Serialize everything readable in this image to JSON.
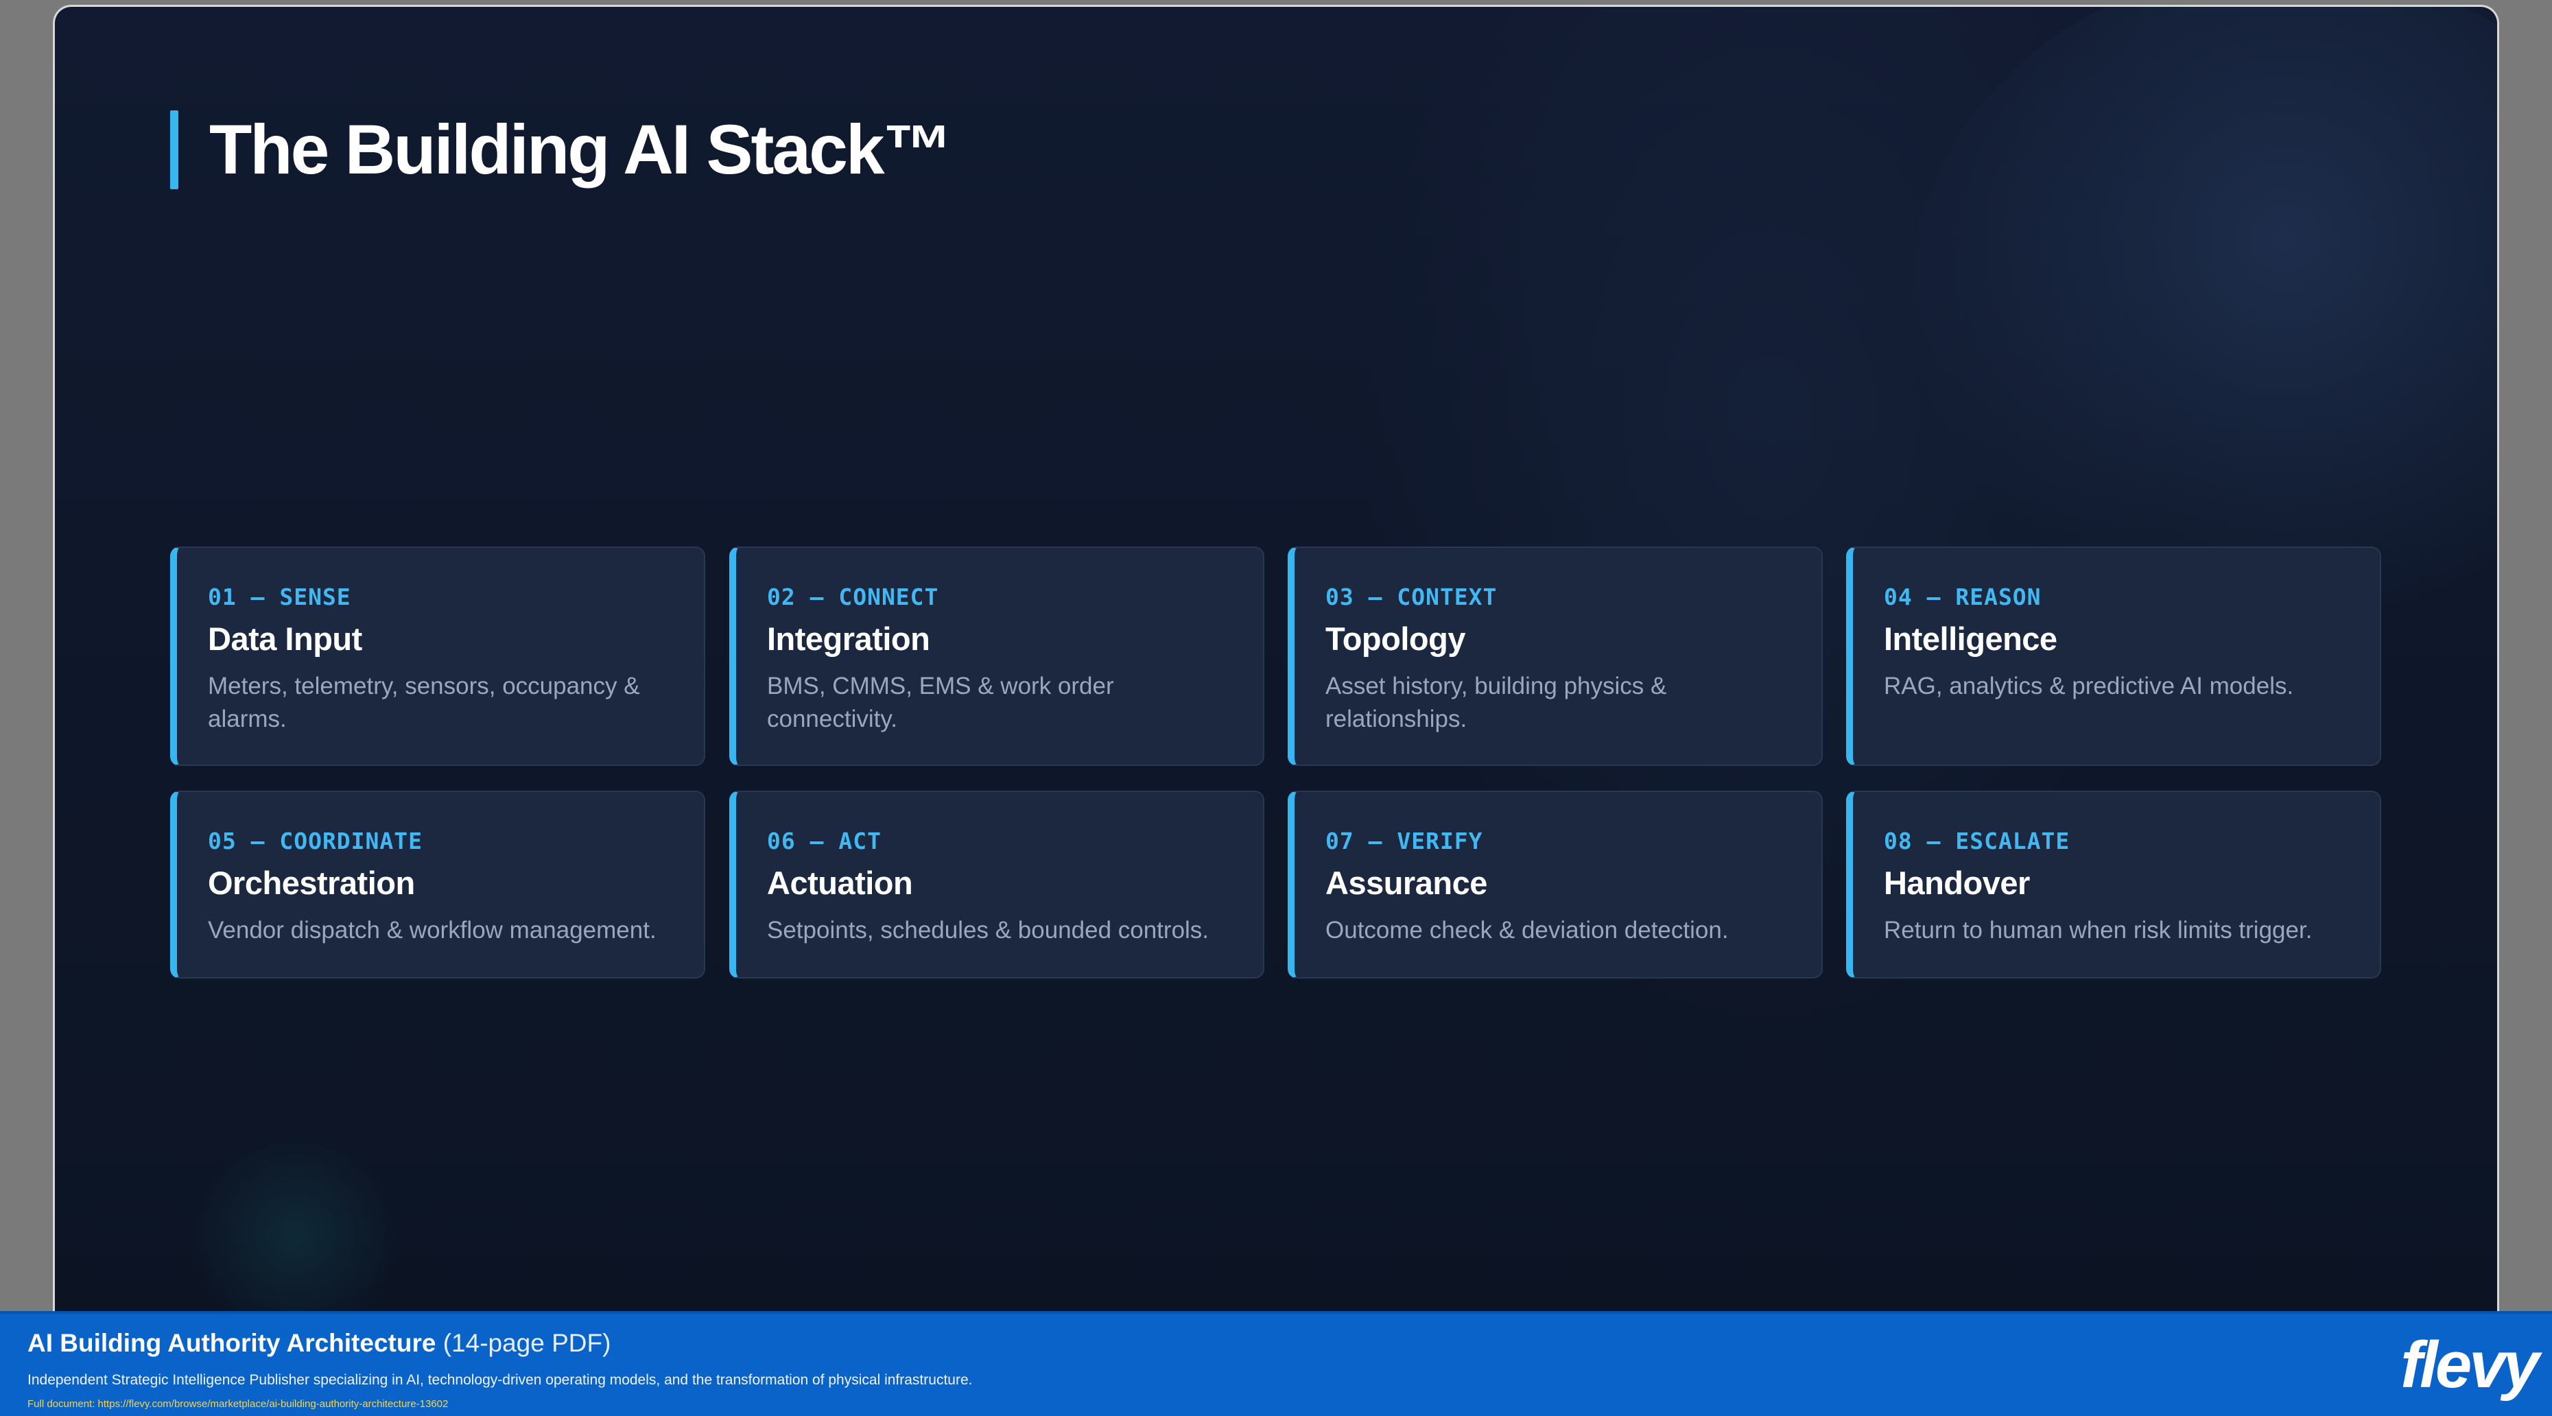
{
  "slide": {
    "title": "The Building AI Stack™"
  },
  "stack": [
    {
      "kicker": "01 — SENSE",
      "title": "Data Input",
      "desc": "Meters, telemetry, sensors, occupancy & alarms."
    },
    {
      "kicker": "02 — CONNECT",
      "title": "Integration",
      "desc": "BMS, CMMS, EMS & work order connectivity."
    },
    {
      "kicker": "03 — CONTEXT",
      "title": "Topology",
      "desc": "Asset history, building physics & relationships."
    },
    {
      "kicker": "04 — REASON",
      "title": "Intelligence",
      "desc": "RAG, analytics & predictive AI models."
    },
    {
      "kicker": "05 — COORDINATE",
      "title": "Orchestration",
      "desc": "Vendor dispatch & workflow management."
    },
    {
      "kicker": "06 — ACT",
      "title": "Actuation",
      "desc": "Setpoints, schedules & bounded controls."
    },
    {
      "kicker": "07 — VERIFY",
      "title": "Assurance",
      "desc": "Outcome check & deviation detection."
    },
    {
      "kicker": "08 — ESCALATE",
      "title": "Handover",
      "desc": "Return to human when risk limits trigger."
    }
  ],
  "footer": {
    "doc_title": "AI Building Authority Architecture",
    "doc_pages": "(14-page PDF)",
    "description": "Independent Strategic Intelligence Publisher specializing in AI, technology-driven operating models, and the transformation of physical infrastructure.",
    "link": "Full document: https://flevy.com/browse/marketplace/ai-building-authority-architecture-13602",
    "logo": "flevy"
  },
  "colors": {
    "accent": "#38b6f0",
    "background": "#0f172a",
    "card": "#1c2740",
    "footer": "#0a63c9",
    "link": "#f7d54a"
  }
}
